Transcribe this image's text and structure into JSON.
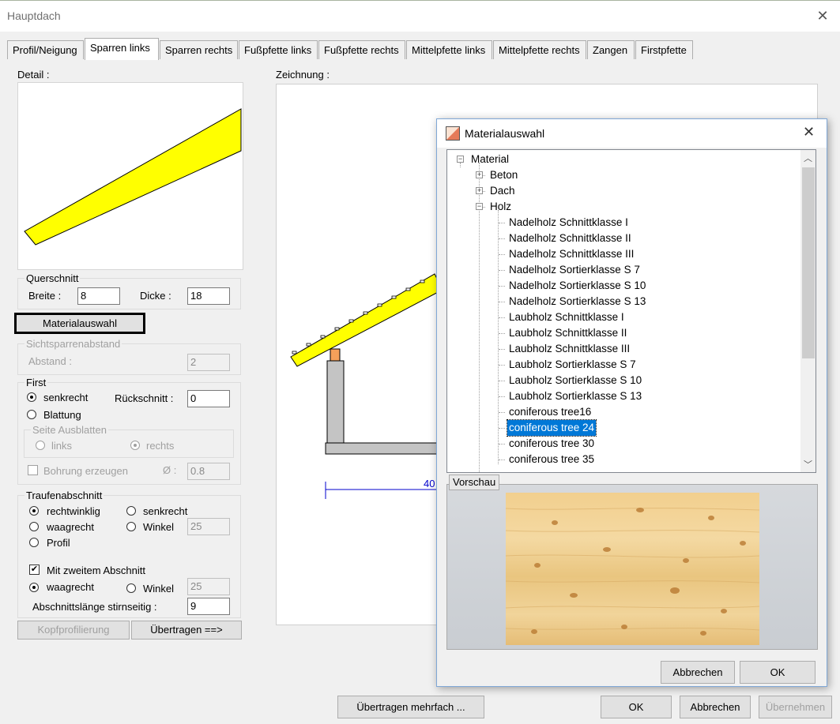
{
  "window": {
    "title": "Hauptdach"
  },
  "tabs": [
    {
      "label": "Profil/Neigung",
      "active": false
    },
    {
      "label": "Sparren links",
      "active": true
    },
    {
      "label": "Sparren rechts",
      "active": false
    },
    {
      "label": "Fußpfette links",
      "active": false
    },
    {
      "label": "Fußpfette rechts",
      "active": false
    },
    {
      "label": "Mittelpfette links",
      "active": false
    },
    {
      "label": "Mittelpfette rechts",
      "active": false
    },
    {
      "label": "Zangen",
      "active": false
    },
    {
      "label": "Firstpfette",
      "active": false
    }
  ],
  "left": {
    "detail_label": "Detail :",
    "querschnitt": {
      "title": "Querschnitt",
      "breite_label": "Breite :",
      "breite": "8",
      "dicke_label": "Dicke :",
      "dicke": "18"
    },
    "materialauswahl_button": "Materialauswahl",
    "sichtsparren": {
      "title": "Sichtsparrenabstand",
      "abstand_label": "Abstand :",
      "abstand": "2"
    },
    "first": {
      "title": "First",
      "senkrecht": "senkrecht",
      "blattung": "Blattung",
      "rueckschnitt_label": "Rückschnitt :",
      "rueckschnitt": "0",
      "seite_title": "Seite Ausblatten",
      "links": "links",
      "rechts": "rechts",
      "bohrung": "Bohrung erzeugen",
      "durchmesser_label": "Ø :",
      "durchmesser": "0.8"
    },
    "traufe": {
      "title": "Traufenabschnitt",
      "rechtwinklig": "rechtwinklig",
      "senkrecht": "senkrecht",
      "waagrecht": "waagrecht",
      "winkel": "Winkel",
      "winkel_value": "25",
      "profil": "Profil",
      "zweiter": "Mit zweitem Abschnitt",
      "waagrecht2": "waagrecht",
      "winkel2": "Winkel",
      "winkel2_value": "25",
      "laenge_label": "Abschnittslänge stirnseitig :",
      "laenge": "9"
    },
    "kopf_button": "Kopfprofilierung",
    "uebertragen_button": "Übertragen ==>"
  },
  "drawing": {
    "label": "Zeichnung :",
    "dimension": "40"
  },
  "bottom": {
    "mehrfach": "Übertragen mehrfach ...",
    "ok": "OK",
    "abbrechen": "Abbrechen",
    "uebernehmen": "Übernehmen"
  },
  "material_dialog": {
    "title": "Materialauswahl",
    "root": "Material",
    "nodes": [
      "Beton",
      "Dach",
      "Holz"
    ],
    "holz_items": [
      "Nadelholz Schnittklasse I",
      "Nadelholz Schnittklasse II",
      "Nadelholz Schnittklasse III",
      "Nadelholz Sortierklasse S 7",
      "Nadelholz Sortierklasse S 10",
      "Nadelholz Sortierklasse S 13",
      "Laubholz Schnittklasse I",
      "Laubholz Schnittklasse II",
      "Laubholz Schnittklasse III",
      "Laubholz Sortierklasse S 7",
      "Laubholz Sortierklasse S 10",
      "Laubholz Sortierklasse S 13",
      "coniferous tree16",
      "coniferous tree 24",
      "coniferous tree 30",
      "coniferous tree 35"
    ],
    "selected": "coniferous tree 24",
    "vorschau": "Vorschau",
    "abbrechen": "Abbrechen",
    "ok": "OK"
  }
}
